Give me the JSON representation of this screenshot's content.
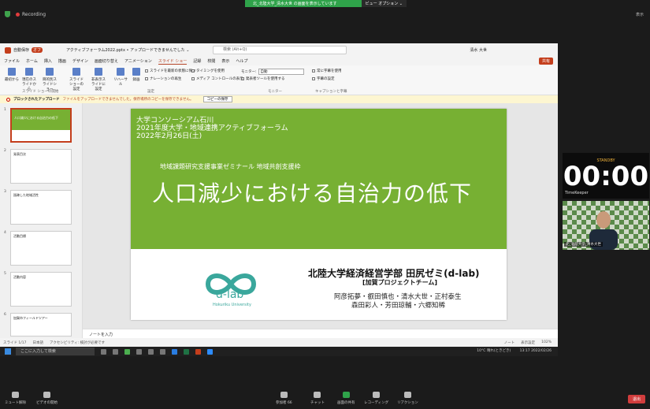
{
  "zoom": {
    "recording": "Recording",
    "share_banner": "北_北陸大学_清水大世 の画面を表示しています",
    "view_options": "ビュー オプション ⌄",
    "top_right": "表示",
    "toolbar": [
      {
        "label": "ミュート解除"
      },
      {
        "label": "ビデオの開始"
      },
      {
        "label": "参加者",
        "count": "66"
      },
      {
        "label": "チャット"
      },
      {
        "label": "画面の共有"
      },
      {
        "label": "レコーディング"
      },
      {
        "label": "リアクション"
      }
    ],
    "leave": "退出"
  },
  "ppt": {
    "autosave": "自動保存",
    "autosave_state": "オフ",
    "filename": "アクティブフォーラム2022.pptx • アップロードできませんでした ⌄",
    "search_placeholder": "検索 (Alt+Q)",
    "user": "清水 大世",
    "menu": [
      "ファイル",
      "ホーム",
      "挿入",
      "描画",
      "デザイン",
      "画面切り替え",
      "アニメーション",
      "スライド ショー",
      "記録",
      "校閲",
      "表示",
      "ヘルプ"
    ],
    "active_menu": "スライド ショー",
    "share": "共有",
    "ribbon": {
      "buttons": [
        "最初から",
        "現在のスライドから",
        "目的別スライドショー",
        "スライド ショーの設定",
        "非表示スライドに設定",
        "リハーサル",
        "録画"
      ],
      "checks": [
        "スライドを最新の状態に保つ",
        "ナレーションの再生",
        "タイミングを使用",
        "メディア コントロールの表示",
        "発表者ツールを使用する",
        "常に字幕を使用",
        "字幕の設定"
      ],
      "monitor_label": "モニター:",
      "monitor_value": "自動",
      "groups": [
        "スライド ショーの開始",
        "設定",
        "モニター",
        "キャプションと字幕"
      ]
    },
    "infobar": {
      "title": "ブロックされたアップロード",
      "message": "ファイルをアップロードできませんでした。保存場所のコピーを保存できません。",
      "button": "コピーの保存"
    },
    "thumbs": [
      {
        "n": "1",
        "text": "人口減少における自治力の低下"
      },
      {
        "n": "2",
        "text": "発表目次"
      },
      {
        "n": "3",
        "text": "過疎した地域活性"
      },
      {
        "n": "4",
        "text": "活動目標"
      },
      {
        "n": "5",
        "text": "活動内容"
      },
      {
        "n": "6",
        "text": "加賀市フィールドツアー"
      }
    ],
    "slide": {
      "head1": "大学コンソーシアム石川",
      "head2": "2021年度大学・地域連携アクティブフォーラム",
      "head3": "2022年2月26日(土)",
      "subtitle": "地域課題研究支援事業ゼミナール 地域共創支援枠",
      "title": "人口減少における自治力の低下",
      "logo_text": "d-lab",
      "logo_sub": "Hokuriku University",
      "org": "北陸大学経済経営学部 田尻ゼミ(d-lab)",
      "team": "[加賀プロジェクトチーム]",
      "names1": "阿彦拓夢・叡田慎也・清水大世・正村泰生",
      "names2": "森田彩人・芳田琼輔・六郷知稀"
    },
    "notes": "ノートを入力",
    "status": [
      "スライド 1/17",
      "日本語",
      "アクセシビリティ: 検討が必要です",
      "ノート",
      "表示設定",
      "102%"
    ]
  },
  "taskbar": {
    "search": "ここに入力して検索",
    "weather": "10°C 晴れ(ときどき)",
    "time": "13:17",
    "date": "2022/02/26"
  },
  "speaker": {
    "status": "STANDBY",
    "clock": "00:00",
    "timekeeper": "TimeKeeper",
    "cam_name": "北_北陸大学_清水大世"
  },
  "colors": {
    "accent": "#77b033",
    "ppt": "#c43e1c",
    "teal": "#3aa79c"
  }
}
